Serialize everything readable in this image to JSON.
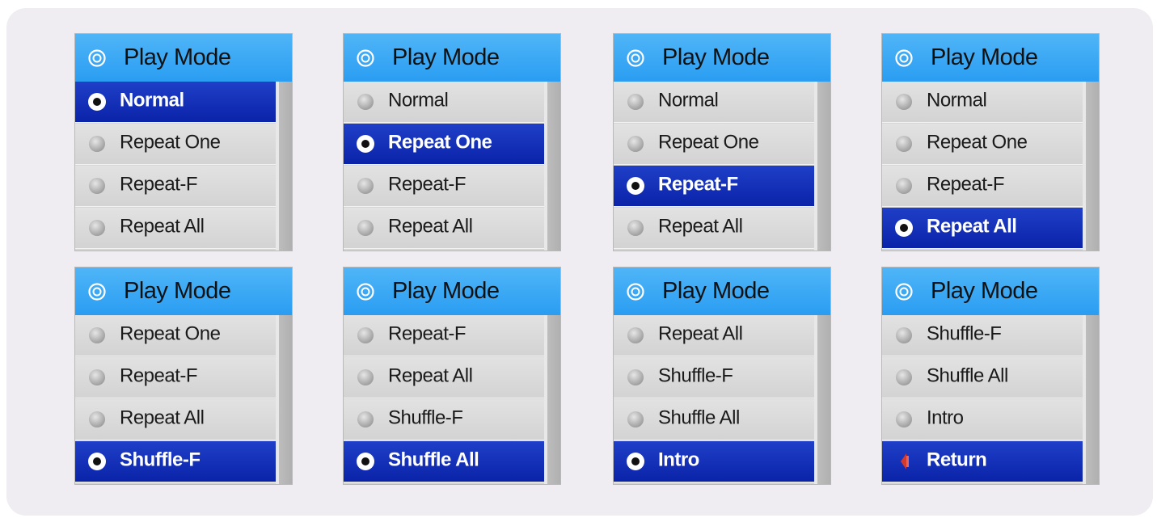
{
  "colors": {
    "header": "#2a9df2",
    "selected_row": "#0a23a8",
    "row": "#d6d6d6",
    "background": "#efedf1"
  },
  "screens": [
    {
      "title": "Play Mode",
      "items": [
        {
          "label": "Normal",
          "icon": "radio-icon",
          "selected": true
        },
        {
          "label": "Repeat One",
          "icon": "radio-icon",
          "selected": false
        },
        {
          "label": "Repeat-F",
          "icon": "radio-icon",
          "selected": false
        },
        {
          "label": "Repeat All",
          "icon": "radio-icon",
          "selected": false
        }
      ]
    },
    {
      "title": "Play Mode",
      "items": [
        {
          "label": "Normal",
          "icon": "radio-icon",
          "selected": false
        },
        {
          "label": "Repeat One",
          "icon": "radio-icon",
          "selected": true
        },
        {
          "label": "Repeat-F",
          "icon": "radio-icon",
          "selected": false
        },
        {
          "label": "Repeat All",
          "icon": "radio-icon",
          "selected": false
        }
      ]
    },
    {
      "title": "Play Mode",
      "items": [
        {
          "label": "Normal",
          "icon": "radio-icon",
          "selected": false
        },
        {
          "label": "Repeat One",
          "icon": "radio-icon",
          "selected": false
        },
        {
          "label": "Repeat-F",
          "icon": "radio-icon",
          "selected": true
        },
        {
          "label": "Repeat All",
          "icon": "radio-icon",
          "selected": false
        }
      ]
    },
    {
      "title": "Play Mode",
      "items": [
        {
          "label": "Normal",
          "icon": "radio-icon",
          "selected": false
        },
        {
          "label": "Repeat One",
          "icon": "radio-icon",
          "selected": false
        },
        {
          "label": "Repeat-F",
          "icon": "radio-icon",
          "selected": false
        },
        {
          "label": "Repeat All",
          "icon": "radio-icon",
          "selected": true
        }
      ]
    },
    {
      "title": "Play Mode",
      "items": [
        {
          "label": "Repeat One",
          "icon": "radio-icon",
          "selected": false
        },
        {
          "label": "Repeat-F",
          "icon": "radio-icon",
          "selected": false
        },
        {
          "label": "Repeat All",
          "icon": "radio-icon",
          "selected": false
        },
        {
          "label": "Shuffle-F",
          "icon": "radio-icon",
          "selected": true
        }
      ]
    },
    {
      "title": "Play Mode",
      "items": [
        {
          "label": "Repeat-F",
          "icon": "radio-icon",
          "selected": false
        },
        {
          "label": "Repeat All",
          "icon": "radio-icon",
          "selected": false
        },
        {
          "label": "Shuffle-F",
          "icon": "radio-icon",
          "selected": false
        },
        {
          "label": "Shuffle All",
          "icon": "radio-icon",
          "selected": true
        }
      ]
    },
    {
      "title": "Play Mode",
      "items": [
        {
          "label": "Repeat All",
          "icon": "radio-icon",
          "selected": false
        },
        {
          "label": "Shuffle-F",
          "icon": "radio-icon",
          "selected": false
        },
        {
          "label": "Shuffle All",
          "icon": "radio-icon",
          "selected": false
        },
        {
          "label": "Intro",
          "icon": "radio-icon",
          "selected": true
        }
      ]
    },
    {
      "title": "Play Mode",
      "items": [
        {
          "label": "Shuffle-F",
          "icon": "radio-icon",
          "selected": false
        },
        {
          "label": "Shuffle All",
          "icon": "radio-icon",
          "selected": false
        },
        {
          "label": "Intro",
          "icon": "radio-icon",
          "selected": false
        },
        {
          "label": "Return",
          "icon": "return-arrow-icon",
          "selected": true
        }
      ]
    }
  ]
}
